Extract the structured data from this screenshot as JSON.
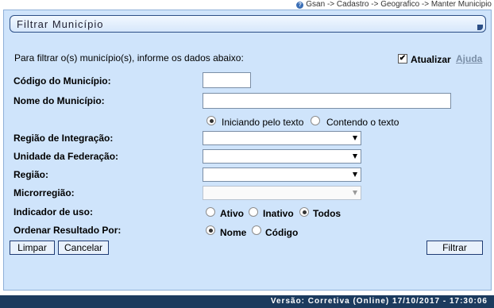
{
  "breadcrumb": "Gsan -> Cadastro -> Geografico -> Manter Municipio",
  "breadcrumb_icon": "help-icon",
  "title": "Filtrar Município",
  "intro": "Para filtrar o(s) município(s), informe os dados abaixo:",
  "atualizar": {
    "label": "Atualizar",
    "checked": true
  },
  "ajuda": "Ajuda",
  "fields": {
    "codigo": {
      "label": "Código do Município:",
      "value": ""
    },
    "nome": {
      "label": "Nome do Município:",
      "value": ""
    },
    "nome_option_start": "Iniciando pelo texto",
    "nome_option_contains": "Contendo o texto",
    "regiao_integracao": {
      "label": "Região de Integração:",
      "value": ""
    },
    "unidade_federacao": {
      "label": "Unidade da Federação:",
      "value": ""
    },
    "regiao": {
      "label": "Região:",
      "value": ""
    },
    "microrregiao": {
      "label": "Microrregião:",
      "value": ""
    },
    "indicador_uso": {
      "label": "Indicador de uso:",
      "options": [
        "Ativo",
        "Inativo",
        "Todos"
      ],
      "selected": "Todos"
    },
    "ordenar": {
      "label": "Ordenar Resultado Por:",
      "options": [
        "Nome",
        "Código"
      ],
      "selected": "Nome"
    }
  },
  "buttons": {
    "limpar": "Limpar",
    "cancelar": "Cancelar",
    "filtrar": "Filtrar"
  },
  "footer": "Versão: Corretiva (Online) 17/10/2017 - 17:30:06",
  "colors": {
    "panel": "#cfe4fb",
    "footer": "#1c3b5e",
    "button_border": "#1f3c74"
  }
}
